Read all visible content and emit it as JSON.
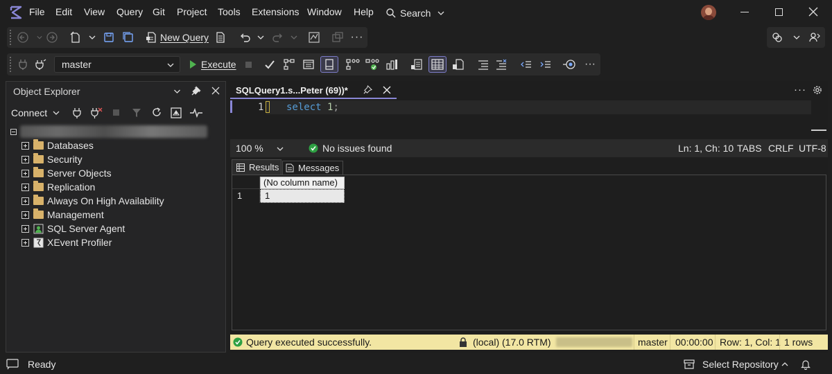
{
  "menu": {
    "file": "File",
    "edit": "Edit",
    "view": "View",
    "query": "Query",
    "git": "Git",
    "project": "Project",
    "tools": "Tools",
    "extensions": "Extensions",
    "window": "Window",
    "help": "Help",
    "search": "Search"
  },
  "toolbar": {
    "new_query": "New Query",
    "database": "master",
    "execute": "Execute"
  },
  "object_explorer": {
    "title": "Object Explorer",
    "connect": "Connect",
    "nodes": [
      {
        "label": "Databases"
      },
      {
        "label": "Security"
      },
      {
        "label": "Server Objects"
      },
      {
        "label": "Replication"
      },
      {
        "label": "Always On High Availability"
      },
      {
        "label": "Management"
      },
      {
        "label": "SQL Server Agent"
      },
      {
        "label": "XEvent Profiler"
      }
    ]
  },
  "editor": {
    "tab_title": "SQLQuery1.s...Peter (69))*",
    "line_number": "1",
    "code_keyword": "select",
    "code_value": "1",
    "code_end": ";",
    "zoom": "100 %",
    "issues": "No issues found",
    "position": "Ln: 1, Ch: 10",
    "tabs": "TABS",
    "line_ending": "CRLF",
    "encoding": "UTF-8"
  },
  "results": {
    "tab_results": "Results",
    "tab_messages": "Messages",
    "column_header": "(No column name)",
    "row_number": "1",
    "cell_value": "1"
  },
  "query_status": {
    "message": "Query executed successfully.",
    "server": "(local) (17.0 RTM)",
    "database": "master",
    "elapsed": "00:00:00",
    "position": "Row: 1, Col: 1",
    "rows": "1 rows"
  },
  "statusbar": {
    "ready": "Ready",
    "select_repository": "Select Repository"
  },
  "colors": {
    "accent": "#8a87d6",
    "status_yellow": "#f2e6a3",
    "success_green": "#2ea043"
  }
}
